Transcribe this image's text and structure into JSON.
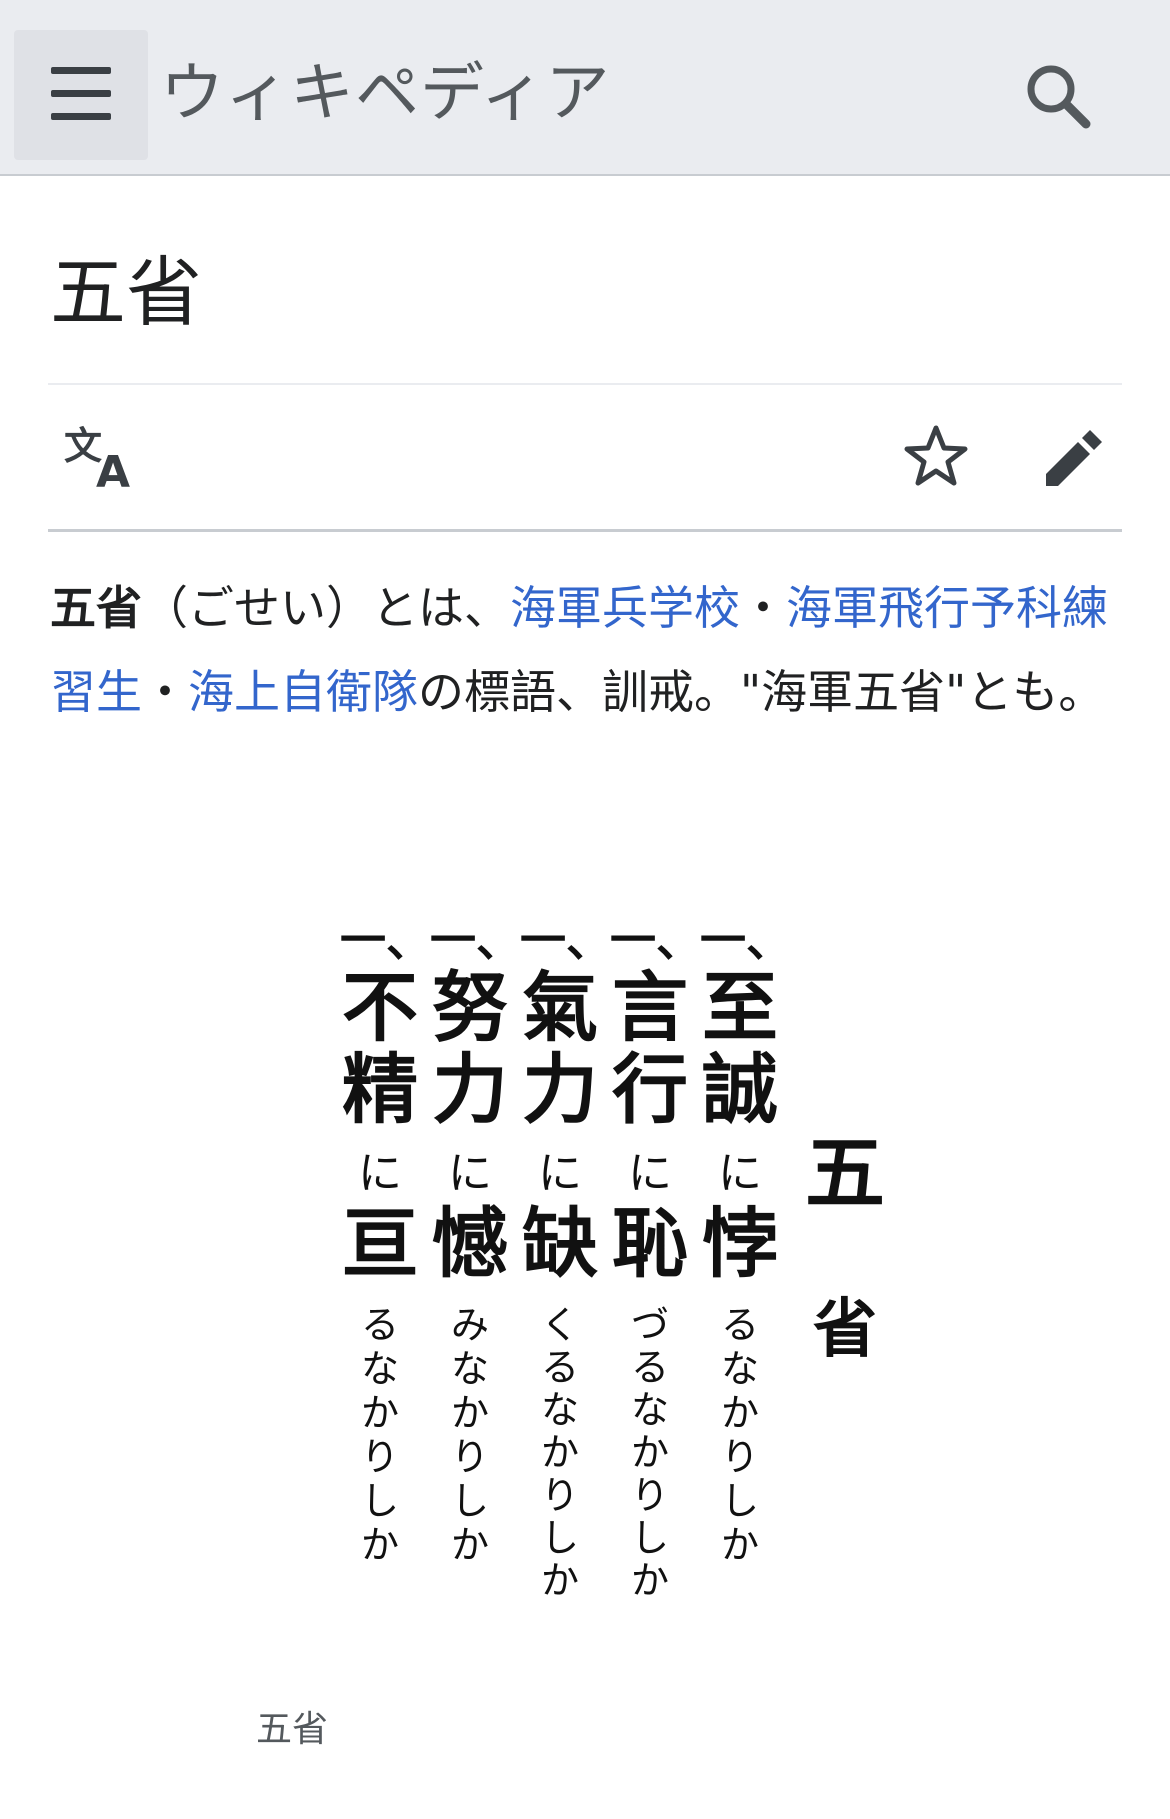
{
  "header": {
    "wordmark": "ウィキペディア",
    "menu_icon": "hamburger-menu-icon",
    "search_icon": "search-icon"
  },
  "article": {
    "title": "五省",
    "actions": {
      "language_icon": "language-icon",
      "watch_icon": "star-icon",
      "edit_icon": "pencil-icon"
    },
    "intro": {
      "bold_term": "五省",
      "text1": "（ごせい）とは、",
      "link1": "海軍兵学校",
      "sep1": "・",
      "link2": "海軍飛行予科練習生",
      "sep2": "・",
      "link3": "海上自衛隊",
      "text2": "の標語、訓戒。\"海軍五省\"とも。"
    },
    "figure": {
      "heading": [
        "五",
        "省"
      ],
      "columns": [
        {
          "mark": "一、",
          "big": "至誠",
          "small1": "に",
          "big2": "悖",
          "tail": "るなかりしか"
        },
        {
          "mark": "一、",
          "big": "言行",
          "small1": "に",
          "big2": "恥",
          "tail": "づるなかりしか"
        },
        {
          "mark": "一、",
          "big": "氣力",
          "small1": "に",
          "big2": "缺",
          "tail": "くるなかりしか"
        },
        {
          "mark": "一、",
          "big": "努力",
          "small1": "に",
          "big2": "憾",
          "tail": "みなかりしか"
        },
        {
          "mark": "一、",
          "big": "不精",
          "small1": "に",
          "big2": "亘",
          "tail": "るなかりしか"
        }
      ],
      "caption": "五省"
    }
  },
  "colors": {
    "link": "#3366cc",
    "header_bg": "#eaecf0",
    "text": "#202122"
  }
}
